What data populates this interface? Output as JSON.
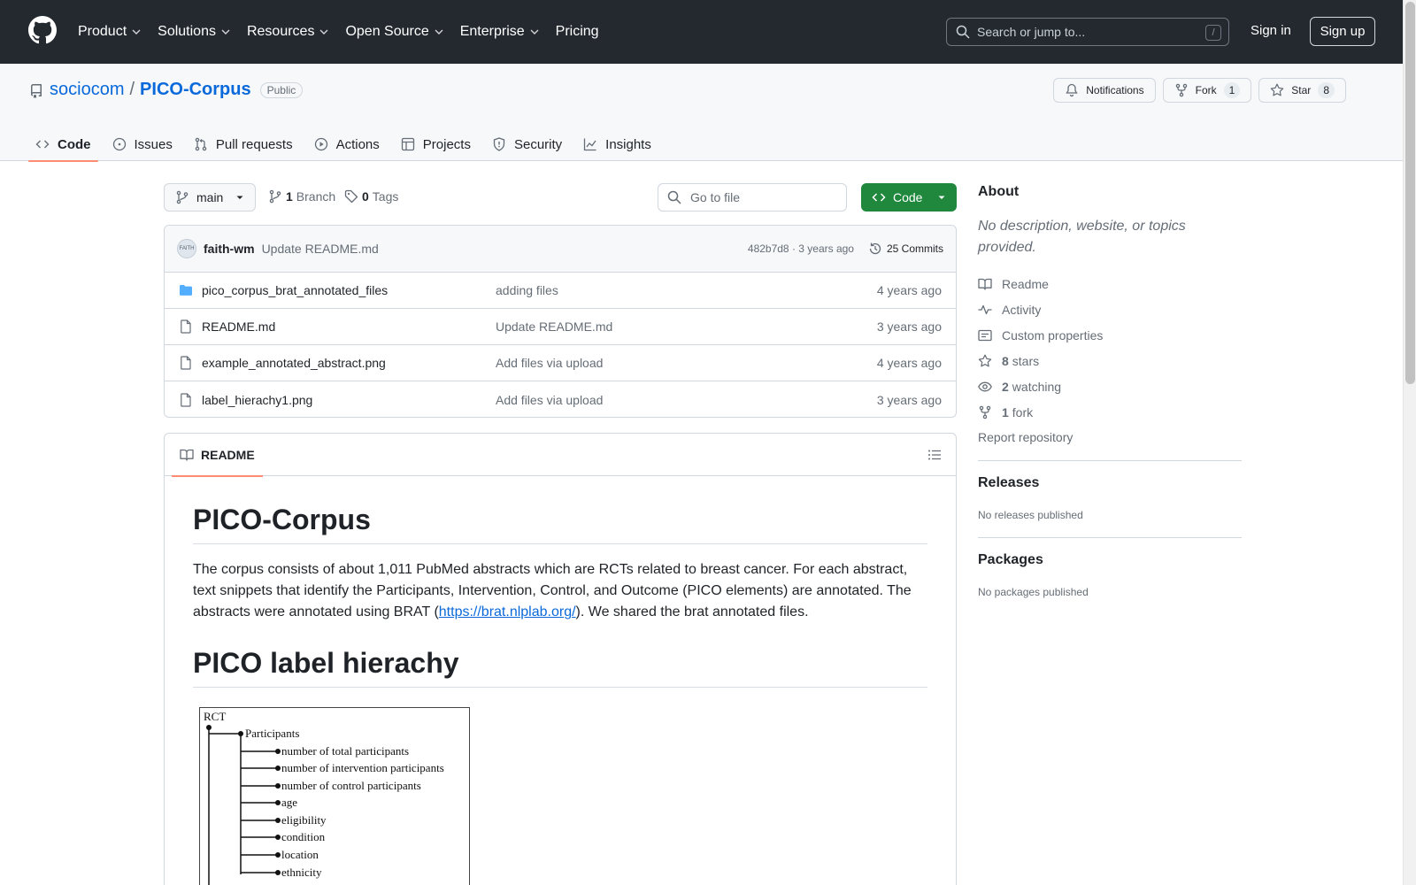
{
  "header": {
    "nav": [
      "Product",
      "Solutions",
      "Resources",
      "Open Source",
      "Enterprise",
      "Pricing"
    ],
    "search_placeholder": "Search or jump to...",
    "search_shortcut": "/",
    "signin": "Sign in",
    "signup": "Sign up"
  },
  "repo": {
    "owner": "sociocom",
    "separator": "/",
    "name": "PICO-Corpus",
    "visibility": "Public",
    "notifications_label": "Notifications",
    "fork_label": "Fork",
    "fork_count": "1",
    "star_label": "Star",
    "star_count": "8"
  },
  "tabs": [
    "Code",
    "Issues",
    "Pull requests",
    "Actions",
    "Projects",
    "Security",
    "Insights"
  ],
  "toolbar": {
    "branch": "main",
    "branch_count": "1",
    "branch_label": "Branch",
    "tag_count": "0",
    "tag_label": "Tags",
    "goto_placeholder": "Go to file",
    "code_button": "Code"
  },
  "commit": {
    "avatar_text": "FAITH",
    "author": "faith-wm",
    "message": "Update README.md",
    "sha_time": "482b7d8 · 3 years ago",
    "count": "25 Commits"
  },
  "files": [
    {
      "type": "dir",
      "name": "pico_corpus_brat_annotated_files",
      "message": "adding files",
      "age": "4 years ago"
    },
    {
      "type": "file",
      "name": "README.md",
      "message": "Update README.md",
      "age": "3 years ago"
    },
    {
      "type": "file",
      "name": "example_annotated_abstract.png",
      "message": "Add files via upload",
      "age": "4 years ago"
    },
    {
      "type": "file",
      "name": "label_hierachy1.png",
      "message": "Add files via upload",
      "age": "3 years ago"
    }
  ],
  "readme": {
    "tab_label": "README",
    "title": "PICO-Corpus",
    "para_before_link": "The corpus consists of about 1,011 PubMed abstracts which are RCTs related to breast cancer. For each abstract, text snippets that identify the Participants, Intervention, Control, and Outcome (PICO elements) are annotated. The abstracts were annotated using BRAT (",
    "link_text": "https://brat.nlplab.org/",
    "para_after_link": "). We shared the brat annotated files.",
    "h2": "PICO label hierachy",
    "diagram": {
      "root": "RCT",
      "group": "Participants",
      "items": [
        "number of total participants",
        "number of intervention participants",
        "number of control participants",
        "age",
        "eligibility",
        "condition",
        "location",
        "ethnicity"
      ]
    }
  },
  "sidebar": {
    "about_title": "About",
    "about_desc": "No description, website, or topics provided.",
    "links": [
      {
        "icon": "book-icon",
        "label": "Readme",
        "count": ""
      },
      {
        "icon": "pulse-icon",
        "label": "Activity",
        "count": ""
      },
      {
        "icon": "note-icon",
        "label": "Custom properties",
        "count": ""
      },
      {
        "icon": "star-icon",
        "label": "stars",
        "count": "8"
      },
      {
        "icon": "eye-icon",
        "label": "watching",
        "count": "2"
      },
      {
        "icon": "fork-icon",
        "label": "fork",
        "count": "1"
      }
    ],
    "report": "Report repository",
    "releases_title": "Releases",
    "releases_text": "No releases published",
    "packages_title": "Packages",
    "packages_text": "No packages published"
  },
  "colors": {
    "header_bg": "#24292f",
    "link_blue": "#0969da",
    "code_green": "#1f883d",
    "tab_underline": "#fd8c73",
    "folder_blue": "#54aeff"
  }
}
